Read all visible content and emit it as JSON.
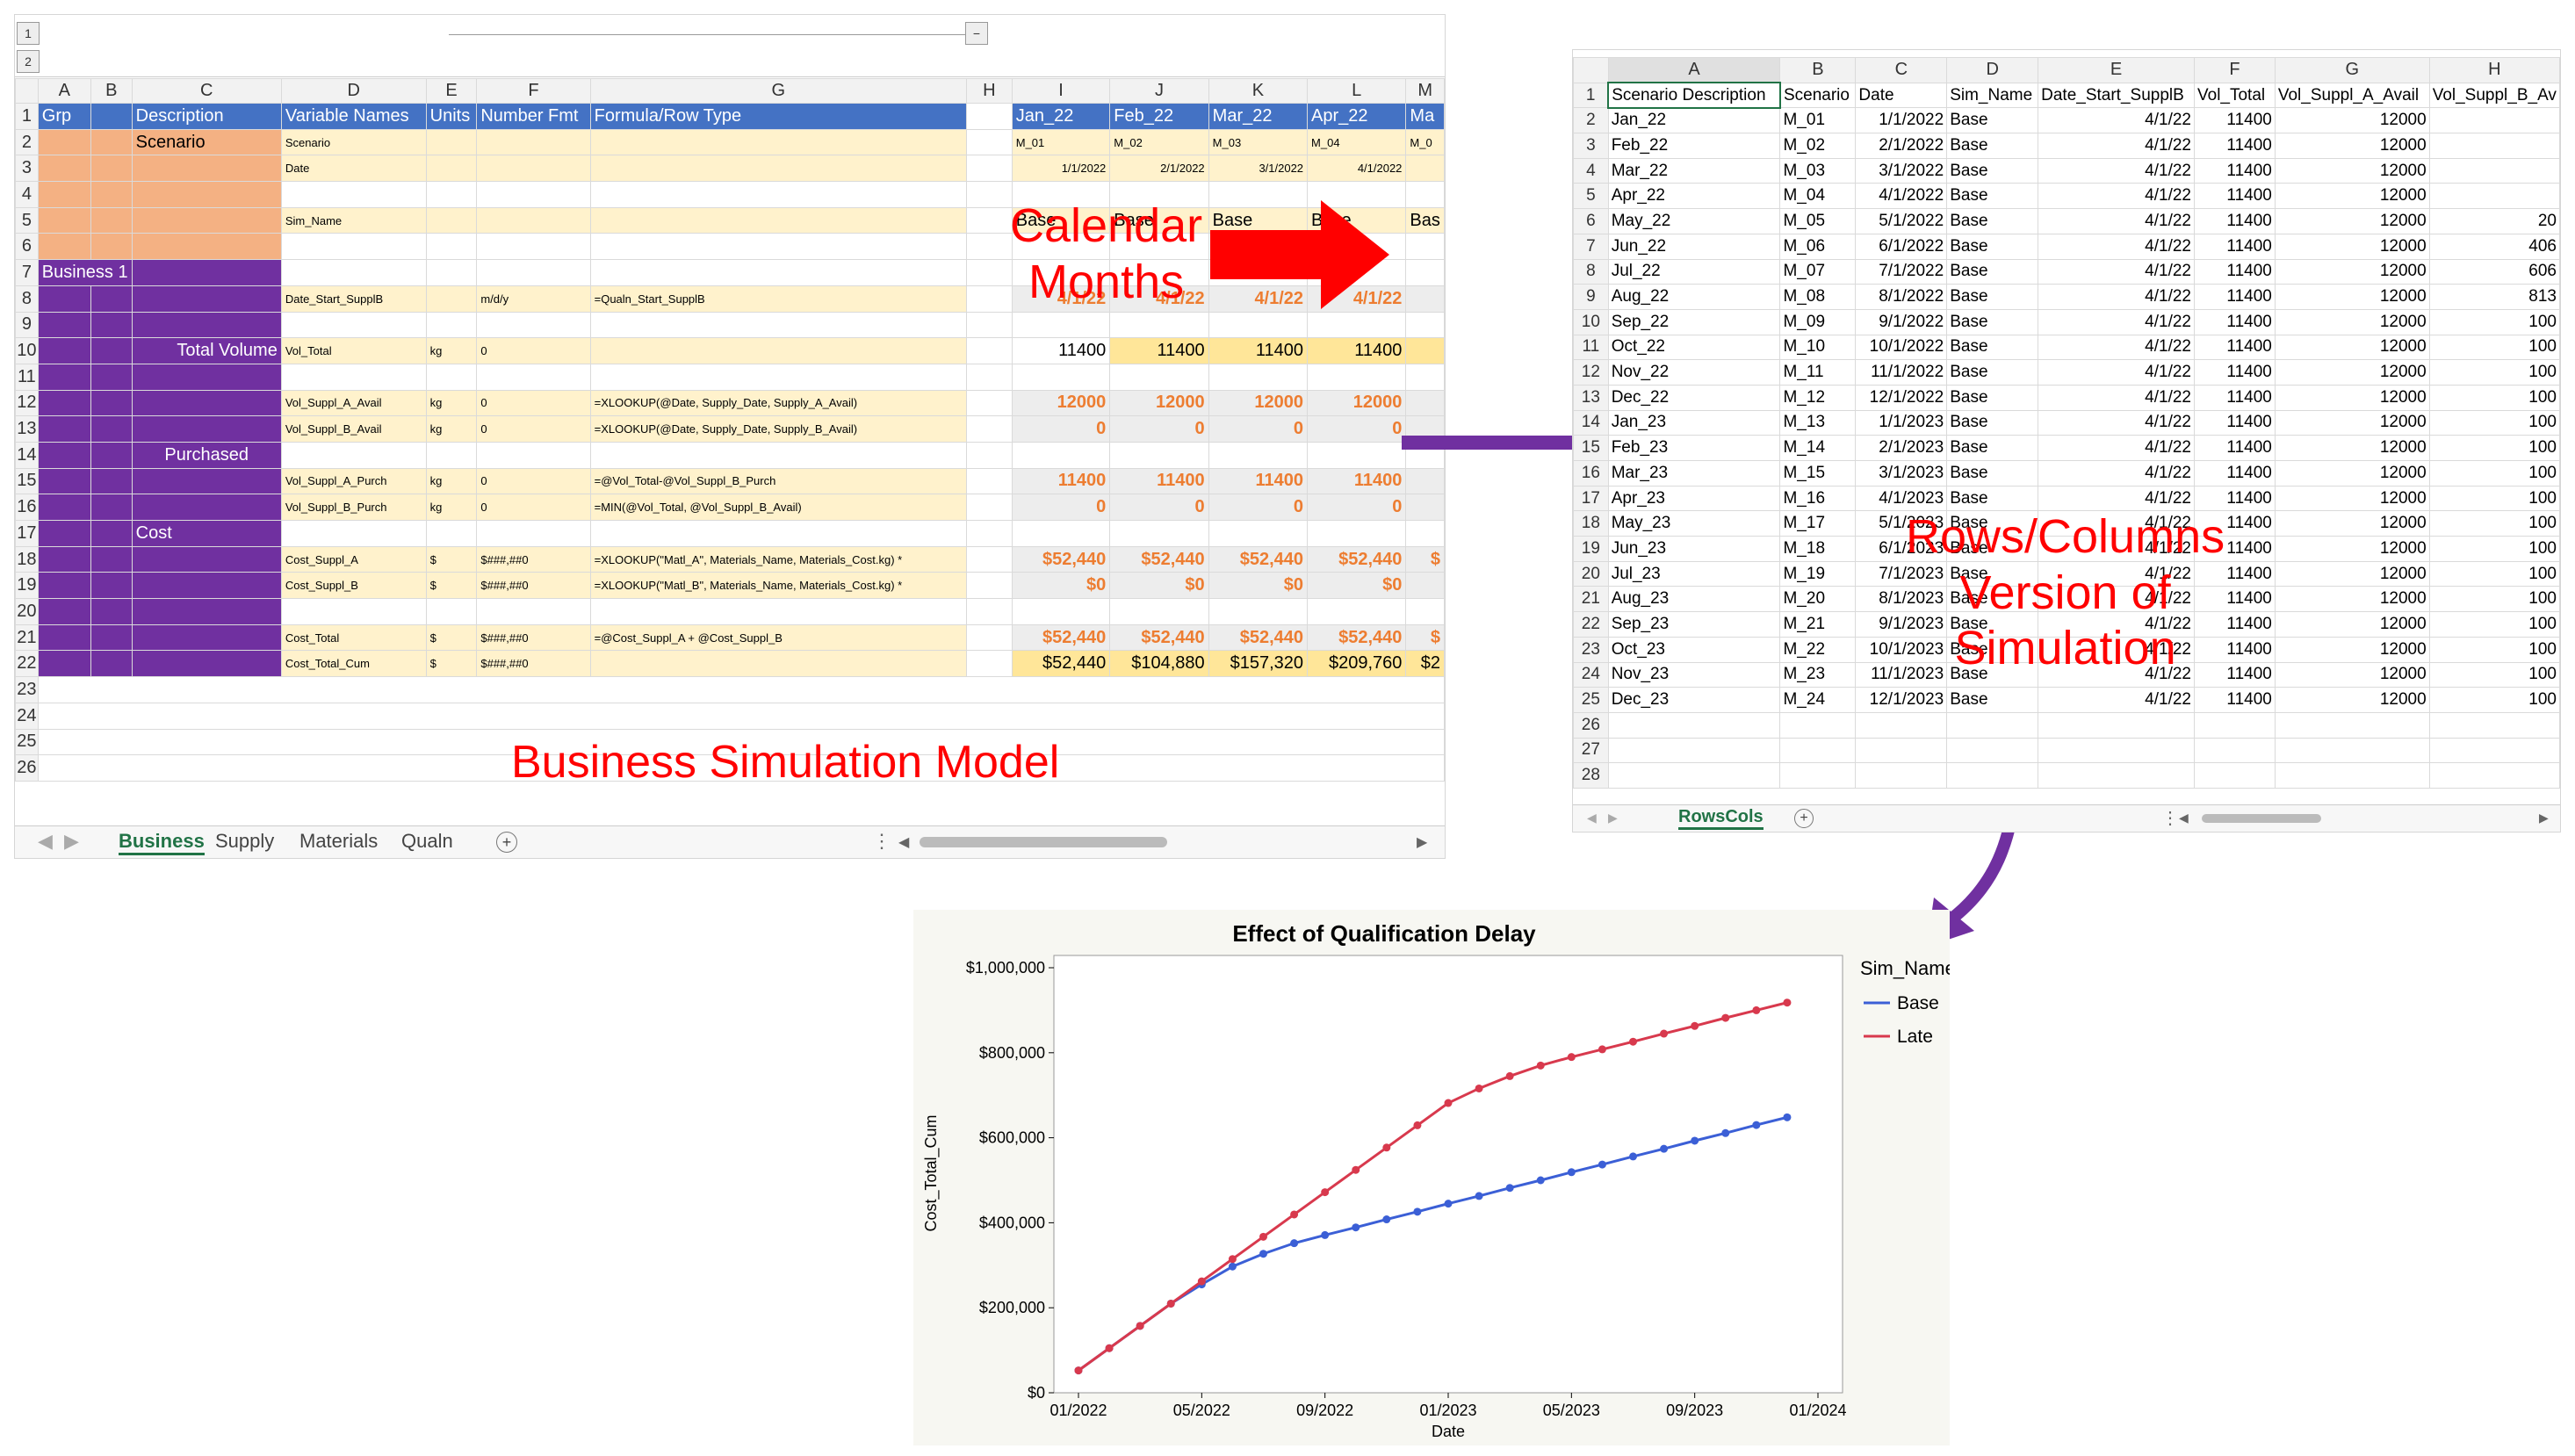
{
  "sheet1": {
    "outline_levels": [
      "1",
      "2"
    ],
    "collapse_btn": "−",
    "col_headers": [
      "A",
      "B",
      "C",
      "D",
      "E",
      "F",
      "G",
      "H",
      "I",
      "J",
      "K",
      "L",
      "M"
    ],
    "row_numbers": [
      "1",
      "2",
      "3",
      "4",
      "5",
      "6",
      "7",
      "8",
      "9",
      "10",
      "11",
      "12",
      "13",
      "14",
      "15",
      "16",
      "17",
      "18",
      "19",
      "20",
      "21",
      "22",
      "23",
      "24",
      "25",
      "26"
    ],
    "header_row": {
      "grp": "Grp",
      "description": "Description",
      "variable_names": "Variable Names",
      "units": "Units",
      "number_fmt": "Number Fmt",
      "formula": "Formula/Row Type",
      "months": [
        "Jan_22",
        "Feb_22",
        "Mar_22",
        "Apr_22",
        "Ma"
      ]
    },
    "scenario_label": "Scenario",
    "business_label": "Business 1",
    "total_volume_label": "Total Volume",
    "purchased_label": "Purchased",
    "cost_label": "Cost",
    "rows": {
      "r2": {
        "var": "Scenario",
        "vals": [
          "M_01",
          "M_02",
          "M_03",
          "M_04",
          "M_0"
        ]
      },
      "r3": {
        "var": "Date",
        "vals": [
          "1/1/2022",
          "2/1/2022",
          "3/1/2022",
          "4/1/2022",
          ""
        ]
      },
      "r5": {
        "var": "Sim_Name",
        "vals": [
          "Base",
          "Base",
          "Base",
          "Base",
          "Bas"
        ]
      },
      "r8": {
        "var": "Date_Start_SupplB",
        "fmt": "m/d/y",
        "formula": "=Qualn_Start_SupplB",
        "vals": [
          "4/1/22",
          "4/1/22",
          "4/1/22",
          "4/1/22",
          ""
        ]
      },
      "r10": {
        "var": "Vol_Total",
        "units": "kg",
        "fmt": "0",
        "vals": [
          "11400",
          "11400",
          "11400",
          "11400",
          ""
        ]
      },
      "r12": {
        "var": "Vol_Suppl_A_Avail",
        "units": "kg",
        "fmt": "0",
        "formula": "=XLOOKUP(@Date, Supply_Date, Supply_A_Avail)",
        "vals": [
          "12000",
          "12000",
          "12000",
          "12000",
          ""
        ]
      },
      "r13": {
        "var": "Vol_Suppl_B_Avail",
        "units": "kg",
        "fmt": "0",
        "formula": "=XLOOKUP(@Date, Supply_Date, Supply_B_Avail)",
        "vals": [
          "0",
          "0",
          "0",
          "0",
          ""
        ]
      },
      "r15": {
        "var": "Vol_Suppl_A_Purch",
        "units": "kg",
        "fmt": "0",
        "formula": "=@Vol_Total-@Vol_Suppl_B_Purch",
        "vals": [
          "11400",
          "11400",
          "11400",
          "11400",
          ""
        ]
      },
      "r16": {
        "var": "Vol_Suppl_B_Purch",
        "units": "kg",
        "fmt": "0",
        "formula": "=MIN(@Vol_Total, @Vol_Suppl_B_Avail)",
        "vals": [
          "0",
          "0",
          "0",
          "0",
          ""
        ]
      },
      "r18": {
        "var": "Cost_Suppl_A",
        "units": "$",
        "fmt": "$###,##0",
        "formula": "=XLOOKUP(\"Matl_A\", Materials_Name, Materials_Cost.kg) *",
        "vals": [
          "$52,440",
          "$52,440",
          "$52,440",
          "$52,440",
          "$"
        ]
      },
      "r19": {
        "var": "Cost_Suppl_B",
        "units": "$",
        "fmt": "$###,##0",
        "formula": "=XLOOKUP(\"Matl_B\", Materials_Name, Materials_Cost.kg) *",
        "vals": [
          "$0",
          "$0",
          "$0",
          "$0",
          ""
        ]
      },
      "r21": {
        "var": "Cost_Total",
        "units": "$",
        "fmt": "$###,##0",
        "formula": "=@Cost_Suppl_A + @Cost_Suppl_B",
        "vals": [
          "$52,440",
          "$52,440",
          "$52,440",
          "$52,440",
          "$"
        ]
      },
      "r22": {
        "var": "Cost_Total_Cum",
        "units": "$",
        "fmt": "$###,##0",
        "vals": [
          "$52,440",
          "$104,880",
          "$157,320",
          "$209,760",
          "$2"
        ]
      }
    },
    "tabs": [
      "Business",
      "Supply",
      "Materials",
      "Qualn"
    ],
    "add_sheet": "+"
  },
  "labels": {
    "calendar_months": [
      "Calendar",
      "Months"
    ],
    "business_model": "Business Simulation Model",
    "rows_columns": [
      "Rows/Columns",
      "Version of",
      "Simulation"
    ]
  },
  "sheet2": {
    "col_headers": [
      "A",
      "B",
      "C",
      "D",
      "E",
      "F",
      "G",
      "H"
    ],
    "headers": [
      "Scenario Description",
      "Scenario",
      "Date",
      "Sim_Name",
      "Date_Start_SupplB",
      "Vol_Total",
      "Vol_Suppl_A_Avail",
      "Vol_Suppl_B_Av"
    ],
    "rows": [
      [
        "Jan_22",
        "M_01",
        "1/1/2022",
        "Base",
        "4/1/22",
        "11400",
        "12000",
        ""
      ],
      [
        "Feb_22",
        "M_02",
        "2/1/2022",
        "Base",
        "4/1/22",
        "11400",
        "12000",
        ""
      ],
      [
        "Mar_22",
        "M_03",
        "3/1/2022",
        "Base",
        "4/1/22",
        "11400",
        "12000",
        ""
      ],
      [
        "Apr_22",
        "M_04",
        "4/1/2022",
        "Base",
        "4/1/22",
        "11400",
        "12000",
        ""
      ],
      [
        "May_22",
        "M_05",
        "5/1/2022",
        "Base",
        "4/1/22",
        "11400",
        "12000",
        "20"
      ],
      [
        "Jun_22",
        "M_06",
        "6/1/2022",
        "Base",
        "4/1/22",
        "11400",
        "12000",
        "406"
      ],
      [
        "Jul_22",
        "M_07",
        "7/1/2022",
        "Base",
        "4/1/22",
        "11400",
        "12000",
        "606"
      ],
      [
        "Aug_22",
        "M_08",
        "8/1/2022",
        "Base",
        "4/1/22",
        "11400",
        "12000",
        "813"
      ],
      [
        "Sep_22",
        "M_09",
        "9/1/2022",
        "Base",
        "4/1/22",
        "11400",
        "12000",
        "100"
      ],
      [
        "Oct_22",
        "M_10",
        "10/1/2022",
        "Base",
        "4/1/22",
        "11400",
        "12000",
        "100"
      ],
      [
        "Nov_22",
        "M_11",
        "11/1/2022",
        "Base",
        "4/1/22",
        "11400",
        "12000",
        "100"
      ],
      [
        "Dec_22",
        "M_12",
        "12/1/2022",
        "Base",
        "4/1/22",
        "11400",
        "12000",
        "100"
      ],
      [
        "Jan_23",
        "M_13",
        "1/1/2023",
        "Base",
        "4/1/22",
        "11400",
        "12000",
        "100"
      ],
      [
        "Feb_23",
        "M_14",
        "2/1/2023",
        "Base",
        "4/1/22",
        "11400",
        "12000",
        "100"
      ],
      [
        "Mar_23",
        "M_15",
        "3/1/2023",
        "Base",
        "4/1/22",
        "11400",
        "12000",
        "100"
      ],
      [
        "Apr_23",
        "M_16",
        "4/1/2023",
        "Base",
        "4/1/22",
        "11400",
        "12000",
        "100"
      ],
      [
        "May_23",
        "M_17",
        "5/1/2023",
        "Base",
        "4/1/22",
        "11400",
        "12000",
        "100"
      ],
      [
        "Jun_23",
        "M_18",
        "6/1/2023",
        "Base",
        "4/1/22",
        "11400",
        "12000",
        "100"
      ],
      [
        "Jul_23",
        "M_19",
        "7/1/2023",
        "Base",
        "4/1/22",
        "11400",
        "12000",
        "100"
      ],
      [
        "Aug_23",
        "M_20",
        "8/1/2023",
        "Base",
        "4/1/22",
        "11400",
        "12000",
        "100"
      ],
      [
        "Sep_23",
        "M_21",
        "9/1/2023",
        "Base",
        "4/1/22",
        "11400",
        "12000",
        "100"
      ],
      [
        "Oct_23",
        "M_22",
        "10/1/2023",
        "Base",
        "4/1/22",
        "11400",
        "12000",
        "100"
      ],
      [
        "Nov_23",
        "M_23",
        "11/1/2023",
        "Base",
        "4/1/22",
        "11400",
        "12000",
        "100"
      ],
      [
        "Dec_23",
        "M_24",
        "12/1/2023",
        "Base",
        "4/1/22",
        "11400",
        "12000",
        "100"
      ]
    ],
    "tab": "RowsCols",
    "add_sheet": "+"
  },
  "colors": {
    "arrow_red": "#ff0000",
    "arrow_purple": "#7030a0",
    "base_line": "#3b5fd6",
    "late_line": "#d8394d"
  },
  "chart_data": {
    "type": "line",
    "title": "Effect of Qualification Delay",
    "xlabel": "Date",
    "ylabel": "Cost_Total_Cum",
    "legend_title": "Sim_Name",
    "legend_position": "right",
    "x_ticks": [
      "01/2022",
      "05/2022",
      "09/2022",
      "01/2023",
      "05/2023",
      "09/2023",
      "01/2024"
    ],
    "y_ticks": [
      "$0",
      "$200,000",
      "$400,000",
      "$600,000",
      "$800,000",
      "$1,000,000"
    ],
    "ylim": [
      0,
      1000000
    ],
    "x": [
      "2022-01",
      "2022-02",
      "2022-03",
      "2022-04",
      "2022-05",
      "2022-06",
      "2022-07",
      "2022-08",
      "2022-09",
      "2022-10",
      "2022-11",
      "2022-12",
      "2023-01",
      "2023-02",
      "2023-03",
      "2023-04",
      "2023-05",
      "2023-06",
      "2023-07",
      "2023-08",
      "2023-09",
      "2023-10",
      "2023-11",
      "2023-12"
    ],
    "series": [
      {
        "name": "Base",
        "values": [
          52440,
          104880,
          157320,
          209760,
          255000,
          297000,
          327000,
          352000,
          371000,
          389000,
          408000,
          426000,
          445000,
          463000,
          482000,
          500000,
          519000,
          537000,
          556000,
          574000,
          593000,
          611000,
          630000,
          648000
        ]
      },
      {
        "name": "Late",
        "values": [
          52440,
          104880,
          157320,
          209760,
          262200,
          314640,
          367080,
          419520,
          471960,
          524400,
          576840,
          629280,
          681720,
          716000,
          745000,
          770000,
          790000,
          808000,
          826000,
          845000,
          863000,
          882000,
          900000,
          918000
        ]
      }
    ]
  }
}
